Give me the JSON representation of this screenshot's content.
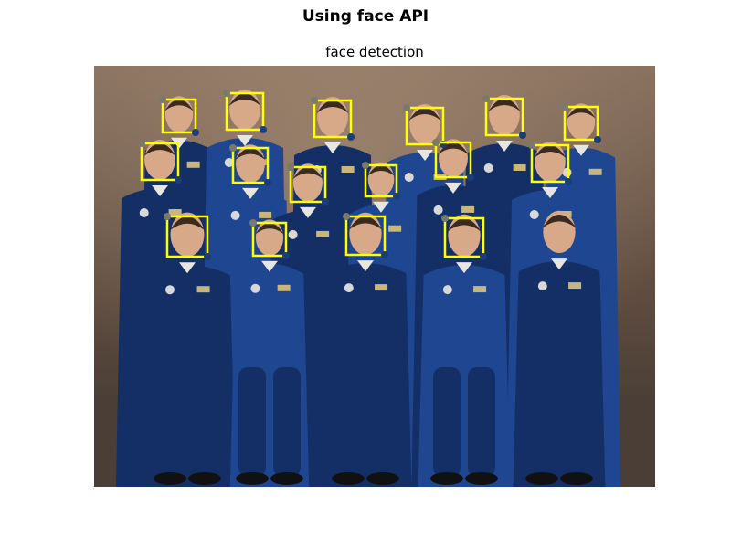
{
  "figure": {
    "title": "Using face API",
    "axes_title": "face detection"
  },
  "image": {
    "subject": "group portrait of astronauts in blue flight suits",
    "colors": {
      "background_top": "#8a7260",
      "background_bottom": "#3c342e",
      "suit": "#1f4690",
      "suit_dark": "#142f66",
      "skin": "#d7a989",
      "hair": "#3a2a20",
      "box": "#ffff00",
      "landmark_left": "#7a7a6a",
      "landmark_right": "#1c3c7a"
    },
    "detections_count": 16
  }
}
